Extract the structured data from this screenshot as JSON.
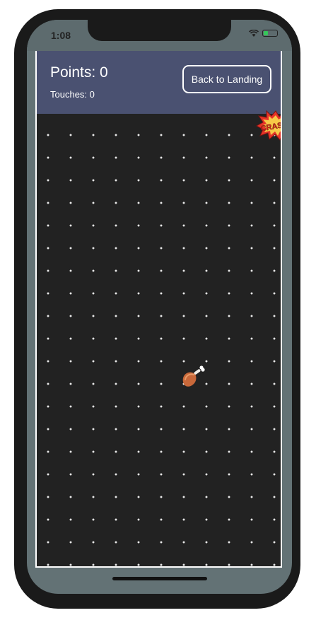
{
  "status_bar": {
    "time": "1:08",
    "wifi_icon": "wifi-icon",
    "battery_icon": "battery-icon",
    "battery_color": "#35c759"
  },
  "header": {
    "points_label": "Points: 0",
    "touches_label": "Touches: 0",
    "back_button_label": "Back to Landing",
    "background": "#4a5171"
  },
  "game": {
    "background": "#222222",
    "crash_icon": "crash-burst-icon",
    "crash_text": "CRASH!",
    "drumstick_icon": "chicken-drumstick-icon"
  }
}
